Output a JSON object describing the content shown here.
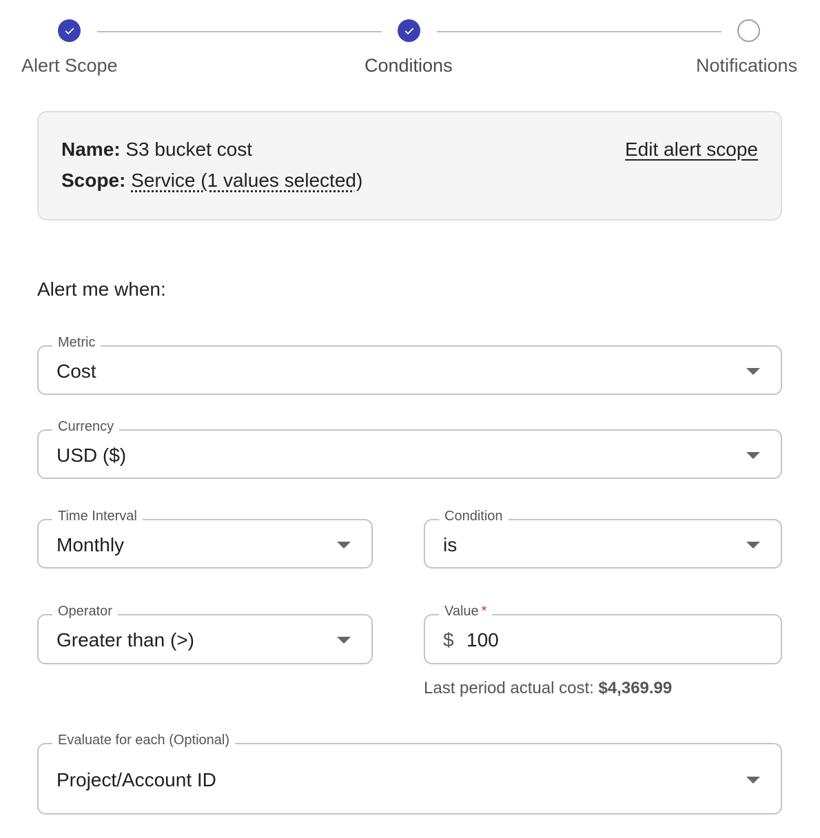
{
  "stepper": {
    "steps": [
      {
        "label": "Alert Scope",
        "state": "completed"
      },
      {
        "label": "Conditions",
        "state": "completed"
      },
      {
        "label": "Notifications",
        "state": "pending"
      }
    ]
  },
  "scope_card": {
    "name_label": "Name:",
    "name_value": "S3 bucket cost",
    "scope_label": "Scope:",
    "scope_value": "Service (1 values selected)",
    "edit_link": "Edit alert scope"
  },
  "form": {
    "title": "Alert me when:",
    "metric": {
      "label": "Metric",
      "value": "Cost"
    },
    "currency": {
      "label": "Currency",
      "value": "USD ($)"
    },
    "time_interval": {
      "label": "Time Interval",
      "value": "Monthly"
    },
    "condition": {
      "label": "Condition",
      "value": "is"
    },
    "operator": {
      "label": "Operator",
      "value": "Greater than (>)"
    },
    "value": {
      "label": "Value",
      "required_marker": "*",
      "prefix": "$",
      "value": "100"
    },
    "helper_text": "Last period actual cost:",
    "helper_amount": "$4,369.99",
    "evaluate": {
      "label": "Evaluate for each (Optional)",
      "value": "Project/Account ID"
    }
  },
  "colors": {
    "accent": "#3c3fb4",
    "required": "#d32f2f"
  }
}
